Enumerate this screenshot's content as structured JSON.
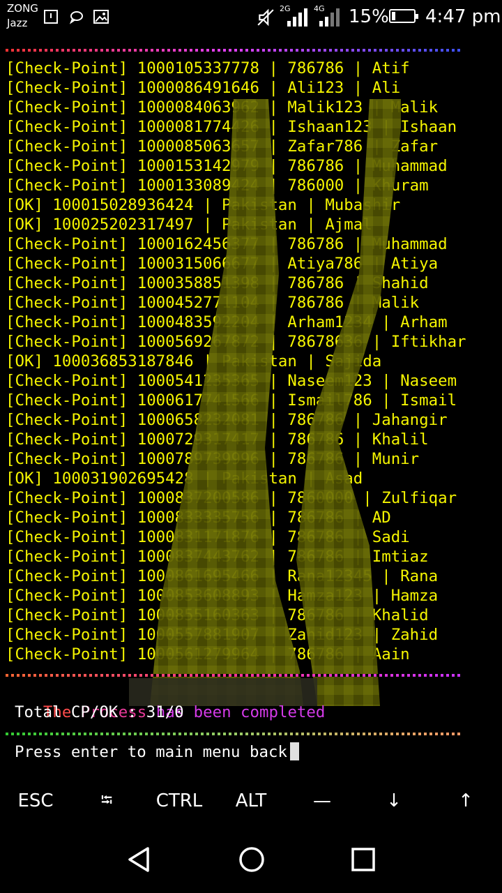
{
  "status_bar": {
    "carrier_line1": "ZONG",
    "carrier_line2": "Jazz",
    "network_1": "2G",
    "network_2": "4G",
    "battery_percent": "15%",
    "battery_level": 0.15,
    "time": "4:47 pm",
    "icons": [
      "notification-icon",
      "chat-icon",
      "image-icon",
      "mute-icon",
      "signal-icon",
      "signal-icon",
      "battery-icon"
    ]
  },
  "terminal": {
    "log_lines": [
      {
        "text": "[Check-Point] 1000105337778 | 786786 | Atif"
      },
      {
        "text": "[Check-Point] 1000086491646 | Ali123 | Ali"
      },
      {
        "text": "[Check-Point] 1000084063962 | Malik123 | Malik"
      },
      {
        "text": "[Check-Point] 1000081774426 | Ishaan123 | Ishaan"
      },
      {
        "text": "[Check-Point] 1000085063657 | Zafar786 | Zafar"
      },
      {
        "text": "[Check-Point] 1000153142979 | 786786 | Muhammad"
      },
      {
        "text": "[Check-Point] 1000133089424 | 786000 | Khuram"
      },
      {
        "text": "[OK] 100015028936424 | Pakistan | Mubashir"
      },
      {
        "text": "[OK] 100025202317497 | Pakistan | Ajmal"
      },
      {
        "text": "[Check-Point] 1000162456377 | 786786 | Muhammad"
      },
      {
        "text": "[Check-Point] 1000315066677 | Atiya786 | Atiya"
      },
      {
        "text": "[Check-Point] 1000358851398 | 786786 | Shahid"
      },
      {
        "text": "[Check-Point] 1000452771104 | 786786 | Malik"
      },
      {
        "text": "[Check-Point] 1000483592204 | Arham1234 | Arham"
      },
      {
        "text": "[Check-Point] 1000569267872 | 78678636 | Iftikhar"
      },
      {
        "text": "[OK] 100036853187846 | Pakistan | Sajida"
      },
      {
        "text": "[Check-Point] 1000541235365 | Naseem123 | Naseem"
      },
      {
        "text": "[Check-Point] 1000617741566 | Ismail786 | Ismail"
      },
      {
        "text": "[Check-Point] 1000658232081 | 786786 | Jahangir"
      },
      {
        "text": "[Check-Point] 1000729317417 | 786786 | Khalil"
      },
      {
        "text": "[Check-Point] 1000789739996 | 786786 | Munir"
      },
      {
        "text": "[OK] 100031902695428 | Pakistan | Asad"
      },
      {
        "text": "[Check-Point] 1000837200586 | 7860000 | Zulfiqar"
      },
      {
        "text": "[Check-Point] 1000833335756 | 786786 | AD"
      },
      {
        "text": "[Check-Point] 1000831171876 | 786786 | Sadi"
      },
      {
        "text": "[Check-Point] 1000837443762 | 786786 | Imtiaz"
      },
      {
        "text": "[Check-Point] 1000861695466 | Rana12345 | Rana"
      },
      {
        "text": "[Check-Point] 1000853608893 | Hamza123 | Hamza"
      },
      {
        "text": "[Check-Point] 1000855160363 | 786786 | Khalid"
      },
      {
        "text": "[Check-Point] 1000557881907 | Zahid123 | Zahid"
      },
      {
        "text": "[Check-Point] 1000561279964 | 786786 | Aain"
      }
    ],
    "message_the": "The",
    "message_process": "Process",
    "message_rest": "has been completed",
    "total_line": "Total CP/OK : 31/0",
    "prompt": "Press enter to main menu back"
  },
  "extra_keys": {
    "esc": "ESC",
    "tab": "⭾",
    "ctrl": "CTRL",
    "alt": "ALT",
    "dash": "—",
    "down": "↓",
    "up": "↑"
  },
  "colors": {
    "log_text": "#f5f500",
    "background": "#000000",
    "msg_the": "#ff4c4c",
    "msg_process": "#e83a9a",
    "msg_rest": "#d43ae8"
  }
}
